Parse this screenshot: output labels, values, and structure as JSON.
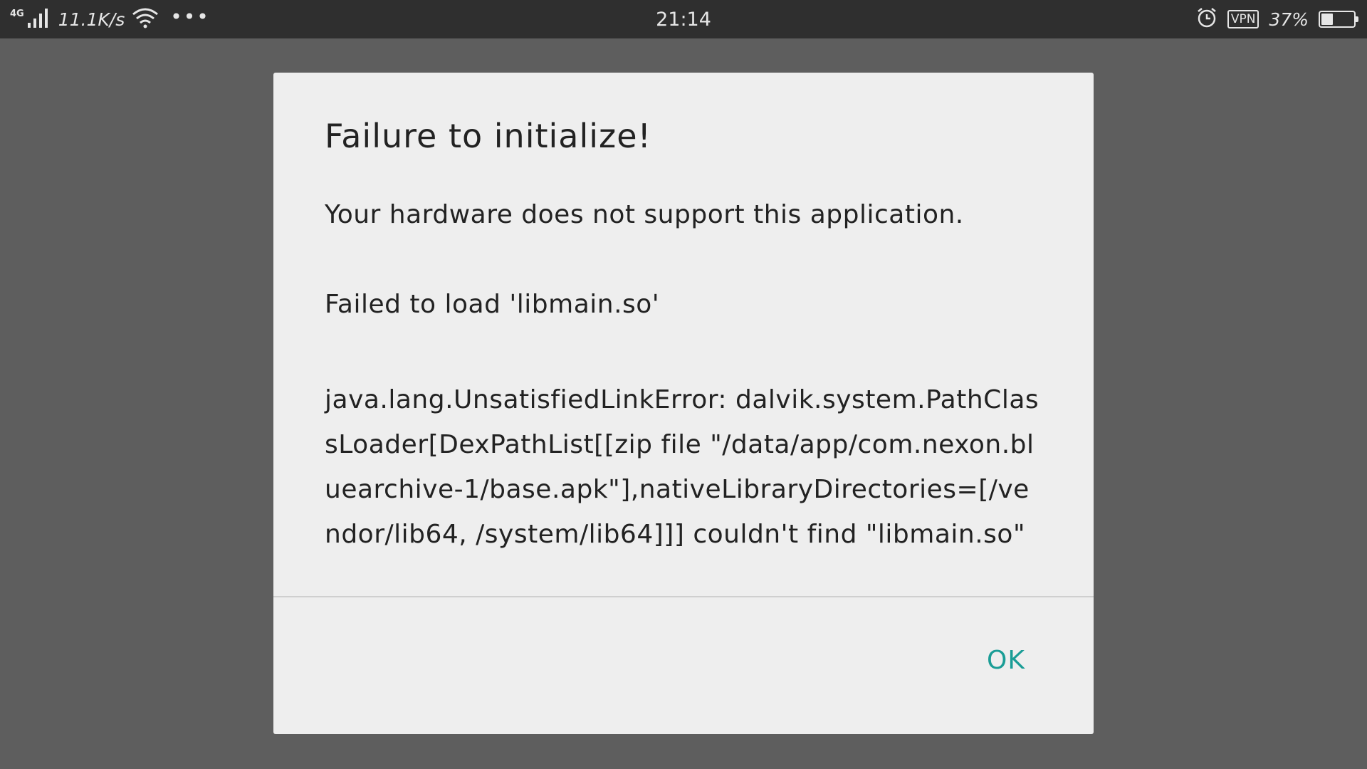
{
  "status_bar": {
    "network_type": "4G",
    "net_speed": "11.1K/s",
    "more": "•••",
    "time": "21:14",
    "vpn": "VPN",
    "battery_percent": "37%",
    "battery_level": 0.37
  },
  "dialog": {
    "title": "Failure to initialize!",
    "message_line1": "Your hardware does not support this application.",
    "message_line2": "Failed to load 'libmain.so'",
    "error_text": "java.lang.UnsatisfiedLinkError: dalvik.system.PathClassLoader[DexPathList[[zip file \"/data/app/com.nexon.bluearchive-1/base.apk\"],nativeLibraryDirectories=[/vendor/lib64, /system/lib64]]] couldn't find \"libmain.so\"",
    "ok_label": "OK"
  },
  "colors": {
    "accent": "#1a9d96",
    "overlay": "#5e5e5e",
    "status_bar": "#2f2f2f",
    "dialog_bg": "#eeeeee"
  }
}
